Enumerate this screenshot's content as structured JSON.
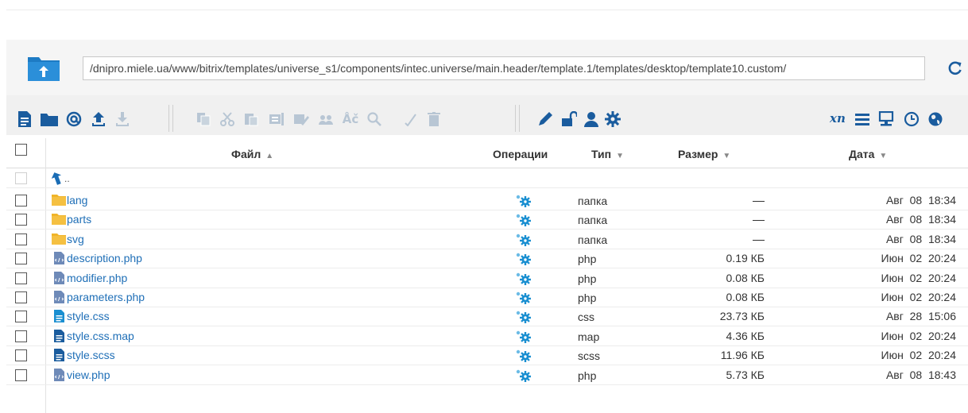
{
  "path": {
    "value": "/dnipro.miele.ua/www/bitrix/templates/universe_s1/components/intec.universe/main.header/template.1/templates/desktop/template10.custom/"
  },
  "toolbar": {
    "icons": [
      "new-file-icon",
      "new-folder-icon",
      "at-icon",
      "upload-icon",
      "download-icon",
      "copy-icon",
      "cut-icon",
      "paste-icon",
      "rename-icon",
      "edit-icon",
      "group-icon",
      "encoding-icon",
      "search-icon",
      "check-icon",
      "delete-icon",
      "pencil-icon",
      "unlock-icon",
      "user-icon",
      "settings-icon",
      "xn-icon",
      "list-icon",
      "monitor-icon",
      "clock-icon",
      "globe-icon"
    ],
    "xn_label": "xn"
  },
  "columns": {
    "file": "Файл",
    "operations": "Операции",
    "type": "Тип",
    "size": "Размер",
    "date": "Дата"
  },
  "up_row": {
    "label": ".."
  },
  "rows": [
    {
      "name": "lang",
      "type": "папка",
      "size": "",
      "date": "Авг  08  18:34",
      "kind": "folder"
    },
    {
      "name": "parts",
      "type": "папка",
      "size": "",
      "date": "Авг  08  18:34",
      "kind": "folder"
    },
    {
      "name": "svg",
      "type": "папка",
      "size": "",
      "date": "Авг  08  18:34",
      "kind": "folder"
    },
    {
      "name": "description.php",
      "type": "php",
      "size": "0.19 КБ",
      "date": "Июн  02  20:24",
      "kind": "php"
    },
    {
      "name": "modifier.php",
      "type": "php",
      "size": "0.08 КБ",
      "date": "Июн  02  20:24",
      "kind": "php"
    },
    {
      "name": "parameters.php",
      "type": "php",
      "size": "0.08 КБ",
      "date": "Июн  02  20:24",
      "kind": "php"
    },
    {
      "name": "style.css",
      "type": "css",
      "size": "23.73 КБ",
      "date": "Авг  28  15:06",
      "kind": "css"
    },
    {
      "name": "style.css.map",
      "type": "map",
      "size": "4.36 КБ",
      "date": "Июн  02  20:24",
      "kind": "doc"
    },
    {
      "name": "style.scss",
      "type": "scss",
      "size": "11.96 КБ",
      "date": "Июн  02  20:24",
      "kind": "doc"
    },
    {
      "name": "view.php",
      "type": "php",
      "size": "5.73 КБ",
      "date": "Авг  08  18:43",
      "kind": "php"
    }
  ],
  "colors": {
    "link": "#1f6fb7",
    "toolbar_icon": "#1a5c9e",
    "toolbar_icon_disabled": "#b8c6d4",
    "folder": "#f0b429",
    "gear": "#1a8fd1"
  }
}
